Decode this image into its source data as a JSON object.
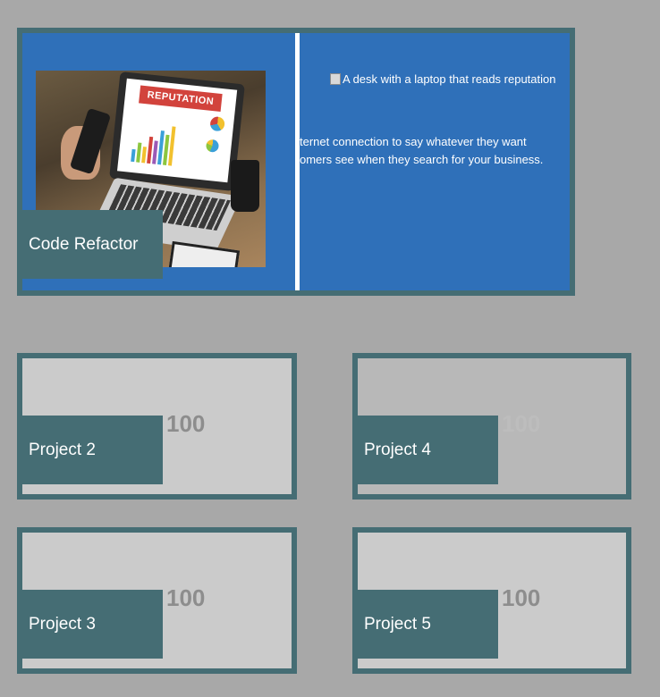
{
  "featured": {
    "label": "Code Refactor",
    "image_banner": "REPUTATION",
    "image_alt": "A desk with a laptop that reads reputation",
    "text_line1": "ternet connection to say whatever they want",
    "text_line2": "omers see when they search for your business."
  },
  "projects": [
    {
      "label": "Project 2",
      "value": "100"
    },
    {
      "label": "Project 4",
      "value": "100"
    },
    {
      "label": "Project 3",
      "value": "100"
    },
    {
      "label": "Project 5",
      "value": "100"
    }
  ],
  "colors": {
    "background": "#a8a8a8",
    "card_border": "#456d74",
    "featured_bg": "#2f70b9",
    "project_bg": "#cbcbcb"
  }
}
